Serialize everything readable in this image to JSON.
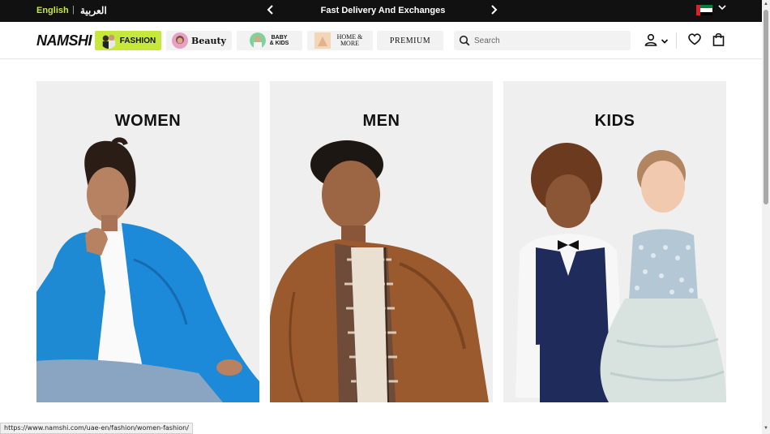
{
  "topbar": {
    "lang_english": "English",
    "lang_separator": "|",
    "lang_arabic": "العربية",
    "promo_text": "Fast Delivery And Exchanges",
    "prev_icon": "chevron-left-icon",
    "next_icon": "chevron-right-icon",
    "country_flag": "uae-flag-icon"
  },
  "header": {
    "logo": "NAMSHI",
    "categories": [
      {
        "label": "FASHION",
        "active": true
      },
      {
        "label": "Beauty"
      },
      {
        "label": "BABY & KIDS"
      },
      {
        "label": "HOME & MORE"
      },
      {
        "label": "PREMIUM"
      }
    ],
    "search_placeholder": "Search",
    "icons": [
      "search-icon",
      "user-icon",
      "heart-icon",
      "shopping-bag-icon"
    ]
  },
  "main": {
    "cards": [
      {
        "title": "WOMEN"
      },
      {
        "title": "MEN"
      },
      {
        "title": "KIDS"
      }
    ]
  },
  "status_bar": {
    "url": "https://www.namshi.com/uae-en/fashion/women-fashion/"
  },
  "colors": {
    "accent": "#c5e83a",
    "topbar_bg": "#111111",
    "card_bg": "#efefef"
  }
}
